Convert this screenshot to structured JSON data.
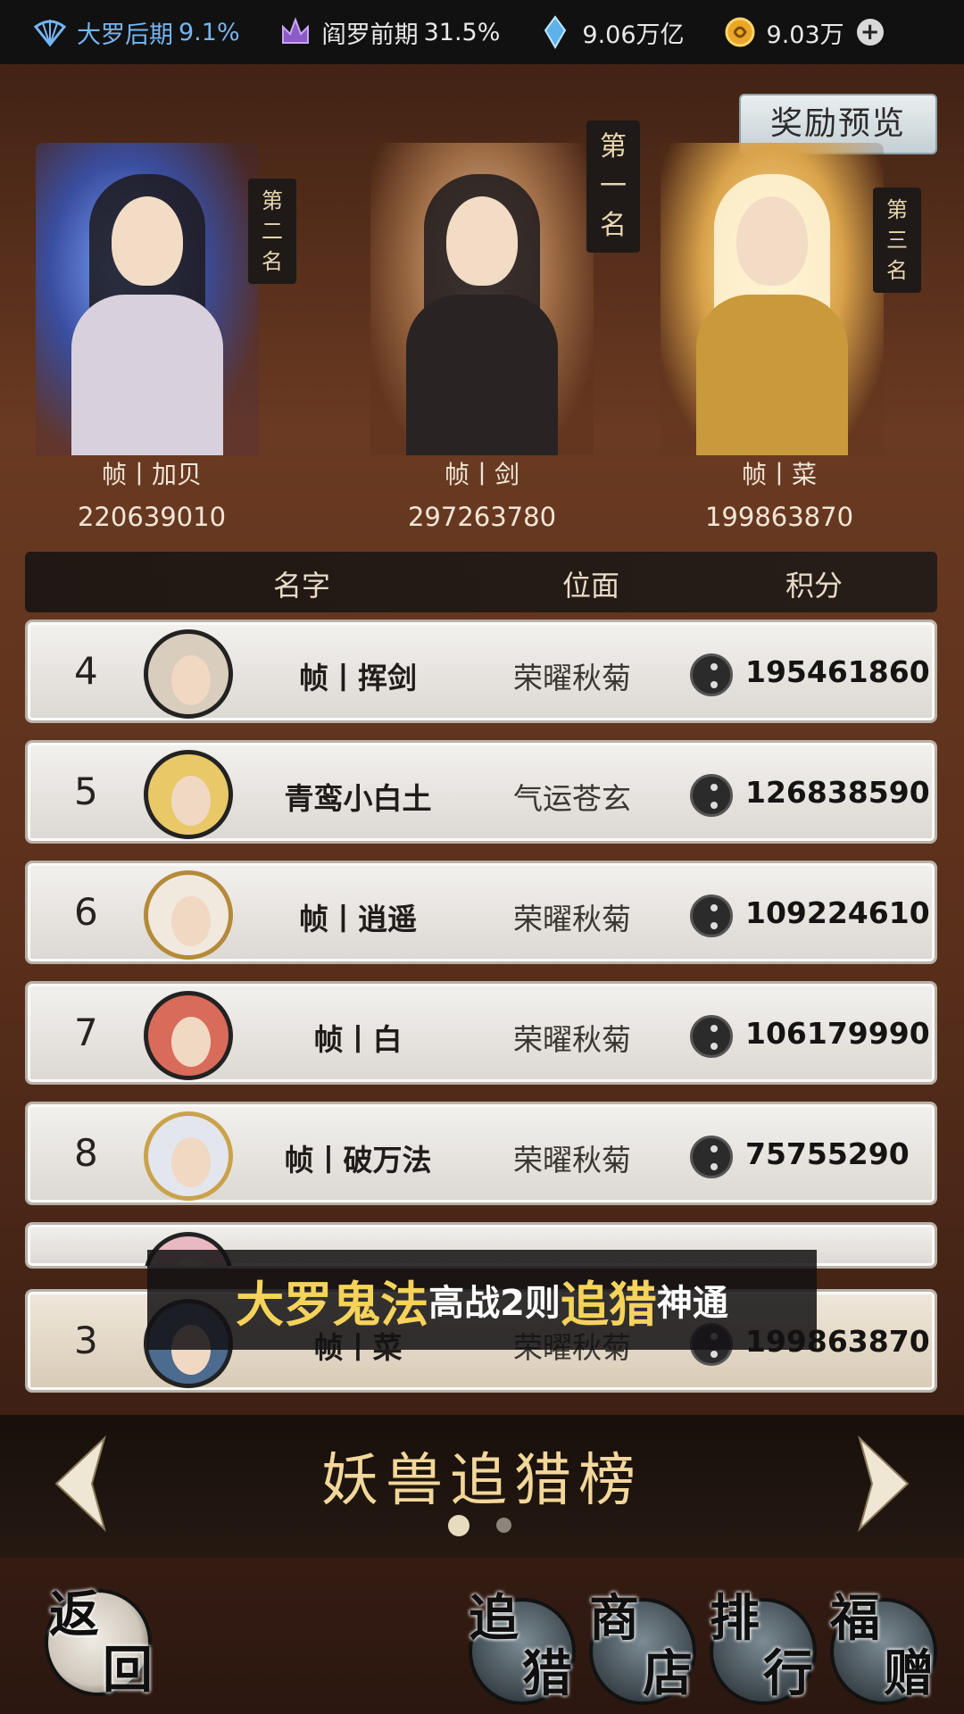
{
  "status_bar": {
    "realm1_label": "大罗后期",
    "realm1_pct": "9.1%",
    "realm2_label": "阎罗前期",
    "realm2_pct": "31.5%",
    "currency1": "9.06万亿",
    "currency2": "9.03万"
  },
  "reward_preview_label": "奖励预览",
  "podium": {
    "first": {
      "badge_chars": [
        "第",
        "一",
        "名"
      ],
      "name": "帧丨剑",
      "score": "297263780"
    },
    "second": {
      "badge_chars": [
        "第",
        "二",
        "名"
      ],
      "name": "帧丨加贝",
      "score": "220639010"
    },
    "third": {
      "badge_chars": [
        "第",
        "三",
        "名"
      ],
      "name": "帧丨菜",
      "score": "199863870"
    }
  },
  "table": {
    "headers": {
      "name": "名字",
      "realm": "位面",
      "score": "积分"
    },
    "rows": [
      {
        "rank": "4",
        "name": "帧丨挥剑",
        "realm": "荣曜秋菊",
        "score": "195461860"
      },
      {
        "rank": "5",
        "name": "青鸾小白土",
        "realm": "气运苍玄",
        "score": "126838590"
      },
      {
        "rank": "6",
        "name": "帧丨逍遥",
        "realm": "荣曜秋菊",
        "score": "109224610"
      },
      {
        "rank": "7",
        "name": "帧丨白",
        "realm": "荣曜秋菊",
        "score": "106179990"
      },
      {
        "rank": "8",
        "name": "帧丨破万法",
        "realm": "荣曜秋菊",
        "score": "75755290"
      }
    ],
    "my_row": {
      "rank": "3",
      "name": "帧丨菜",
      "realm": "荣曜秋菊",
      "score": "199863870"
    }
  },
  "caption": {
    "p1": "大罗鬼法",
    "p2": "高战2则",
    "p3": "追猎",
    "p4": "神通"
  },
  "board_title": "妖兽追猎榜",
  "pager": {
    "page_count": 2,
    "active_page": 1
  },
  "bottom_buttons": {
    "back": [
      "返",
      "回"
    ],
    "hunt": [
      "追",
      "猎"
    ],
    "shop": [
      "商",
      "店"
    ],
    "rank": [
      "排",
      "行"
    ],
    "gift": [
      "福",
      "赠"
    ]
  },
  "colors": {
    "accent_gold": "#f2d79a",
    "caption_yellow": "#f5d35a",
    "realm_blue": "#76b6f2"
  }
}
